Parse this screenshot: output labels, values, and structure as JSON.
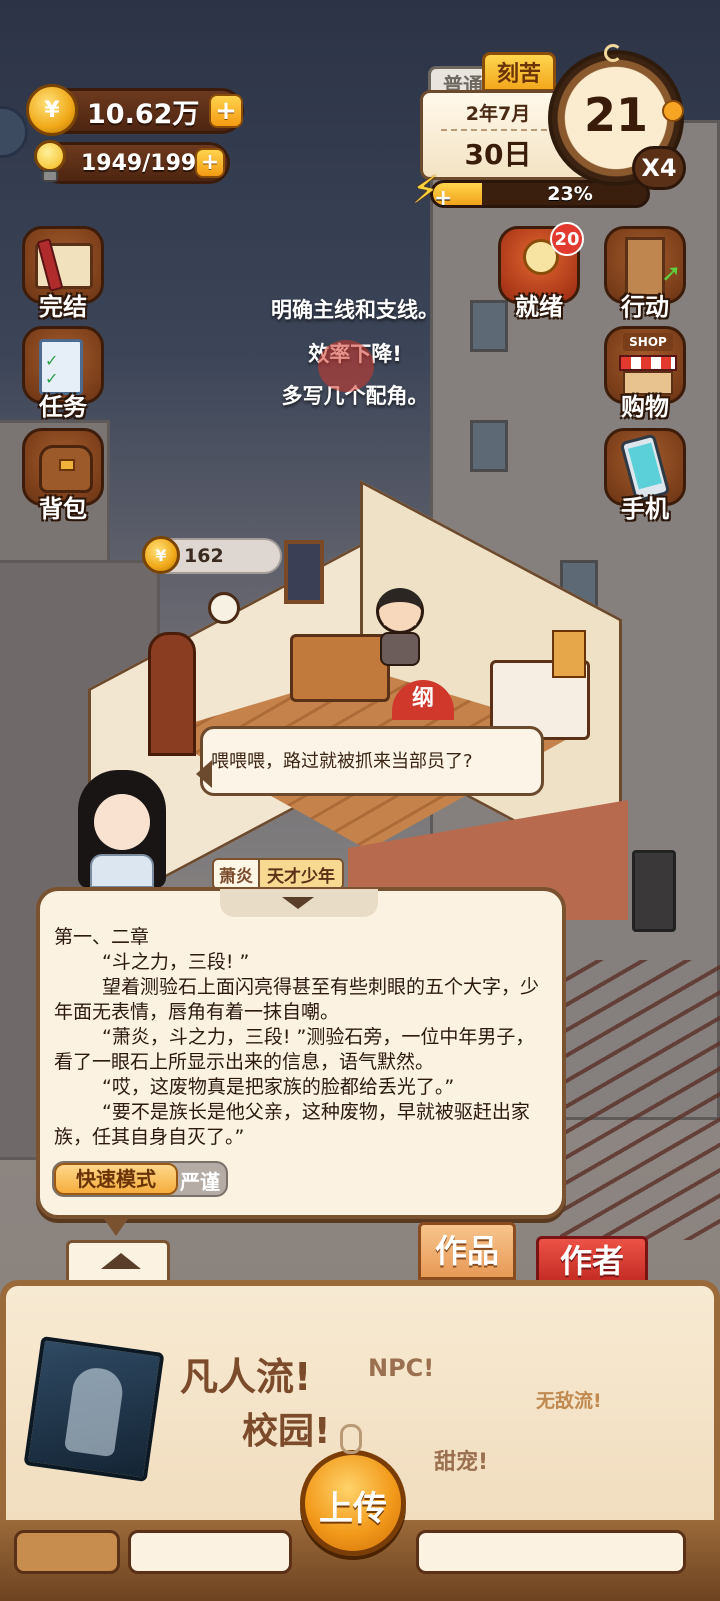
{
  "hud": {
    "coins": "10.62万",
    "energy": "1949/1999",
    "mode_tabs": [
      "普通",
      "刻苦"
    ],
    "date_year_month": "2年7月",
    "date_day": "30日",
    "progress_percent": "23%",
    "progress_fraction": 0.23,
    "day_counter": "21",
    "speed": "X4"
  },
  "left_menu": [
    "完结",
    "任务",
    "背包"
  ],
  "right_menu": {
    "ready_label": "就绪",
    "ready_badge": "20",
    "items": [
      "行动",
      "购物",
      "手机"
    ],
    "shop_sign": "SHOP"
  },
  "notices": [
    "明确主线和支线。",
    "效率下降!",
    "多写几个配角。"
  ],
  "room": {
    "coin_bubble": "162",
    "speech": "喂喂喂，路过就被抓来当部员了?",
    "stamp": "纲"
  },
  "character": {
    "name": "萧炎",
    "trait": "天才少年"
  },
  "story_panel": {
    "chapter": "第一、二章",
    "paragraphs": [
      "“斗之力，三段! ”",
      "望着测验石上面闪亮得甚至有些刺眼的五个大字，少年面无表情，唇角有着一抹自嘲。",
      "“萧炎，斗之力，三段! ”测验石旁，一位中年男子，看了一眼石上所显示出来的信息，语气默然。",
      "“哎，这废物真是把家族的脸都给丢光了。”",
      "“要不是族长是他父亲，这种废物，早就被驱赶出家族，任其自身自灭了。”"
    ],
    "mode_active": "快速模式",
    "mode_other": "严谨"
  },
  "tabs": [
    "作品",
    "作者"
  ],
  "tray": {
    "tropes": [
      "凡人流!",
      "NPC!",
      "无敌流!",
      "校园!",
      "甜宠!"
    ],
    "upload_label": "上传"
  },
  "colors": {
    "accent_orange": "#f39b12",
    "wood_brown": "#7a5230",
    "paper": "#fbf2e1",
    "author_red": "#d23a32"
  }
}
